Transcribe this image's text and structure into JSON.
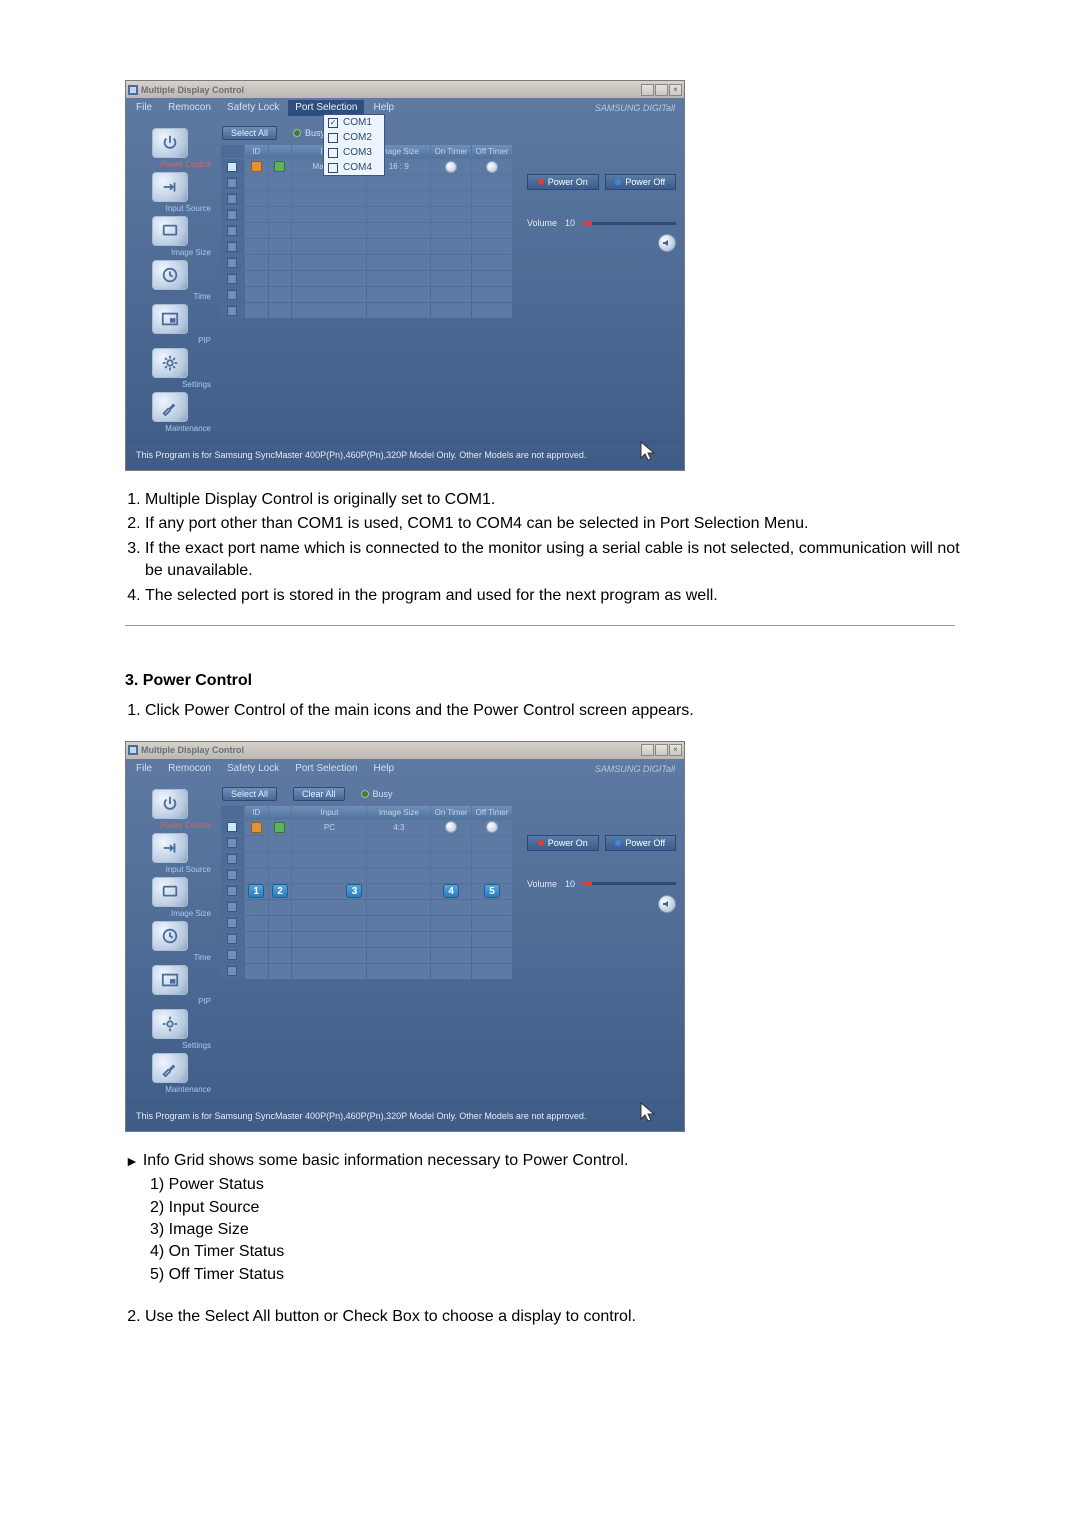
{
  "app_title": "Multiple Display Control",
  "brand": "SAMSUNG DIGITall",
  "menu": {
    "file": "File",
    "remocon": "Remocon",
    "safety": "Safety Lock",
    "port": "Port Selection",
    "help": "Help"
  },
  "port_menu": [
    "COM1",
    "COM2",
    "COM3",
    "COM4"
  ],
  "toolbar": {
    "select_all": "Select All",
    "clear_all": "Clear All",
    "busy": "Busy"
  },
  "headers": {
    "id": "ID",
    "power": " ",
    "input": "Input",
    "image_size": "Image Size",
    "on_timer": "On Timer",
    "off_timer": "Off Timer"
  },
  "row1": {
    "input1": "MagicNet",
    "isize1": "16 : 9",
    "input2": "PC",
    "isize2": "4:3"
  },
  "side": {
    "power": "Power Control",
    "input": "Input Source",
    "image": "Image Size",
    "time": "Time",
    "pip": "PIP",
    "settings": "Settings",
    "maint": "Maintenance"
  },
  "right": {
    "power_on": "Power On",
    "power_off": "Power Off",
    "volume": "Volume",
    "vol_value": "10"
  },
  "footer": "This Program is for Samsung SyncMaster 400P(Pn),460P(Pn),320P  Model Only. Other Models are not approved.",
  "doc1": {
    "i1": "Multiple Display Control is originally set to COM1.",
    "i2": "If any port other than COM1 is used, COM1 to COM4 can be selected in Port Selection Menu.",
    "i3": "If the exact port name which is connected to the monitor using a serial cable is not selected, communication will not be unavailable.",
    "i4": "The selected port is stored in the program and used for the next program as well."
  },
  "section3_title": "3. Power Control",
  "section3_line1": "Click Power Control of the main icons and the Power Control screen appears.",
  "doc2": {
    "info": "Info Grid shows some basic information necessary to Power Control.",
    "a": "1) Power Status",
    "b": "2) Input Source",
    "c": "3) Image Size",
    "d": "4) On Timer Status",
    "e": "5) Off Timer Status",
    "i2": "Use the Select All button or Check Box to choose a display to control."
  }
}
